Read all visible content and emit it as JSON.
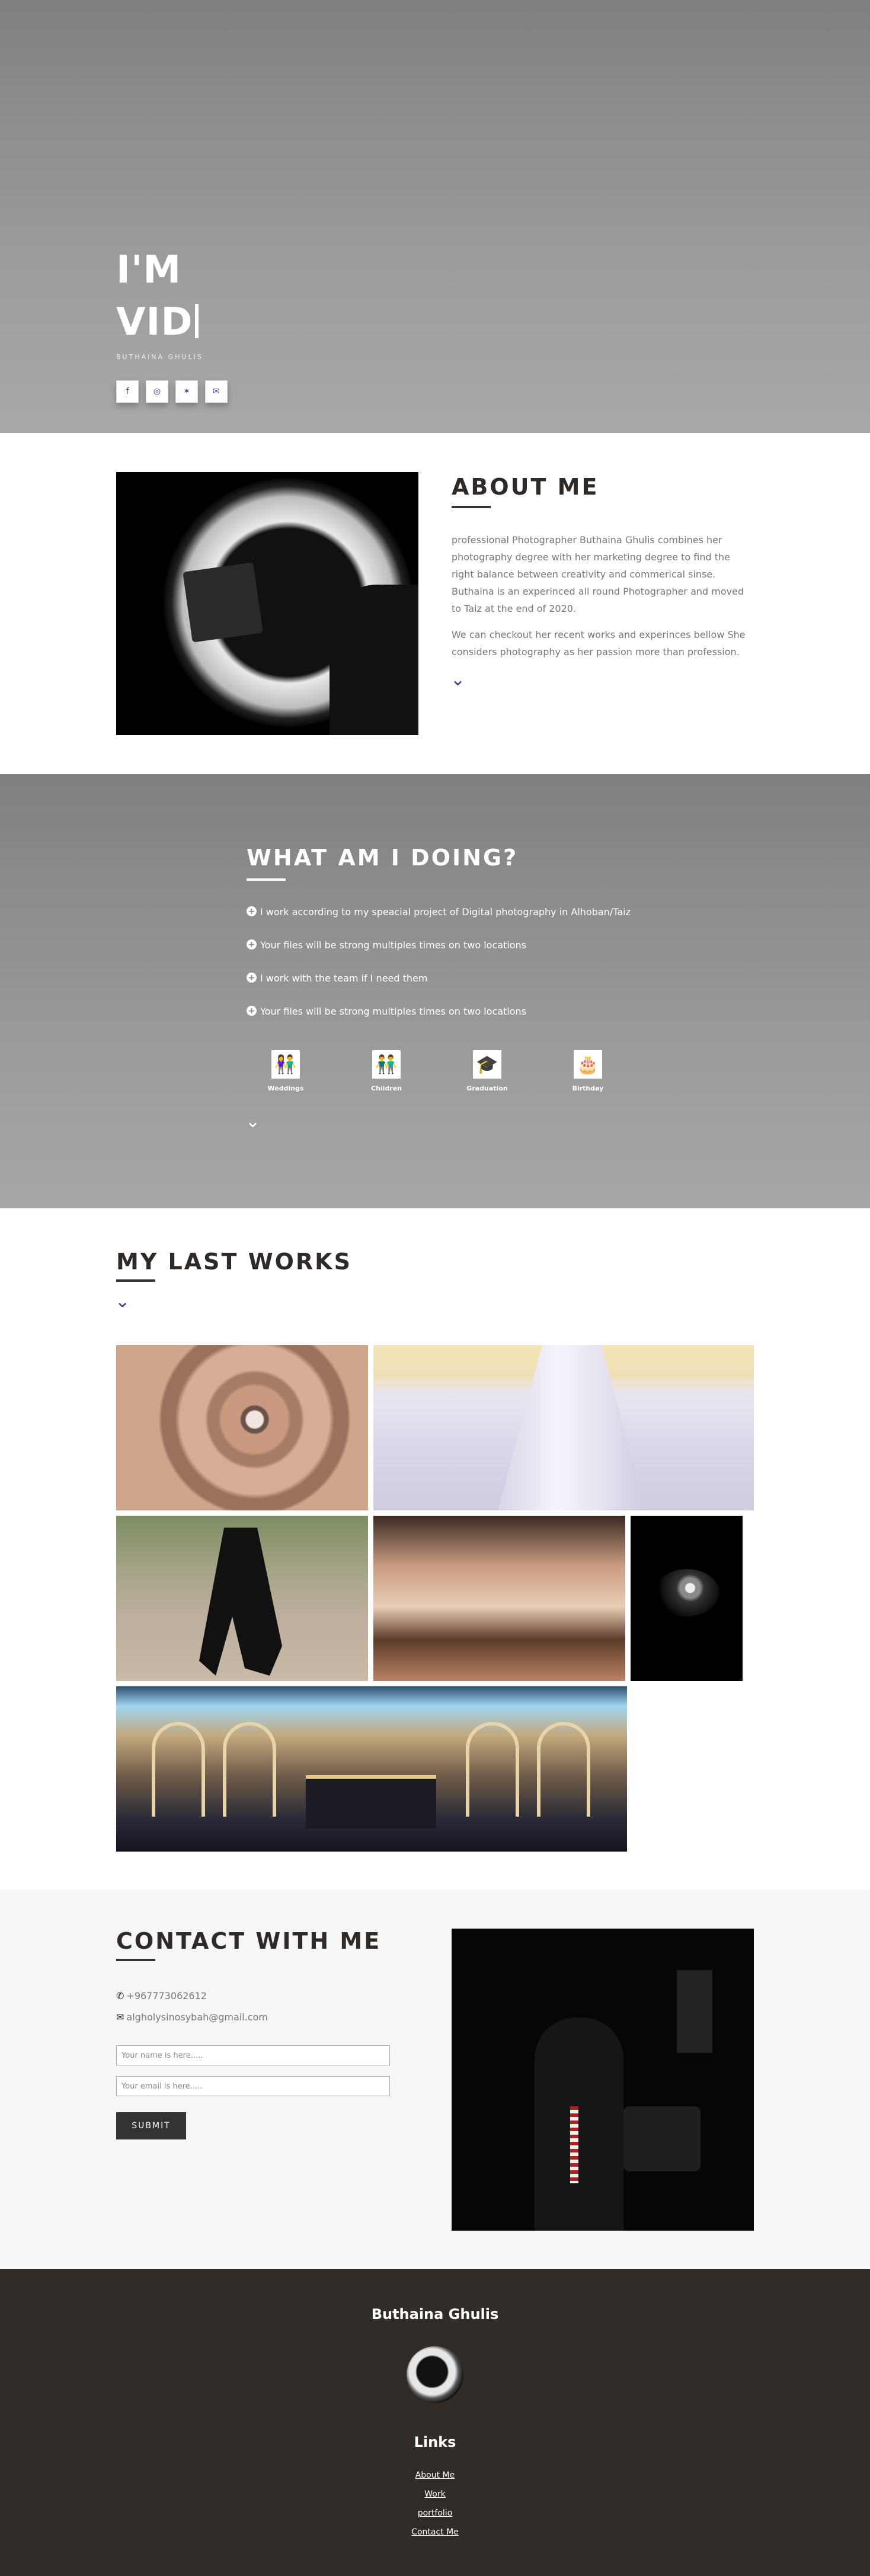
{
  "hero": {
    "title_line1": "I'M",
    "title_line2": "VID",
    "subtitle": "Buthaina Ghulis",
    "socials": [
      {
        "icon": "facebook-icon",
        "glyph": "f"
      },
      {
        "icon": "instagram-icon",
        "glyph": "◎"
      },
      {
        "icon": "twitter-icon",
        "glyph": "✶"
      },
      {
        "icon": "email-icon",
        "glyph": "✉"
      }
    ]
  },
  "about": {
    "heading": "ABOUT ME",
    "para1": "professional Photographer Buthaina Ghulis combines her photography degree with her marketing degree to find the right balance between creativity and commerical sinse. Buthaina is an experinced all round Photographer and moved to Taiz at the end of 2020.",
    "para2": "We can checkout her recent works and experinces bellow She considers photography as her passion more than profession.",
    "chevron": "⌄"
  },
  "doing": {
    "heading": "WHAT AM I DOING?",
    "items": [
      "I work according to my speacial project of Digital photography in Alhoban/Taiz",
      "Your files will be strong multiples times on two locations",
      "I work with the team if I need them",
      "Your files will be strong multiples times on two locations"
    ],
    "categories": [
      {
        "label": "Weddings",
        "icon": "wedding-couple-icon",
        "glyph": "👫"
      },
      {
        "label": "Children",
        "icon": "children-icon",
        "glyph": "👬"
      },
      {
        "label": "Graduation",
        "icon": "graduation-cap-icon",
        "glyph": "🎓"
      },
      {
        "label": "Birthday",
        "icon": "birthday-cake-icon",
        "glyph": "🎂"
      }
    ],
    "chevron": "⌄"
  },
  "works": {
    "heading": "MY LAST WORKS",
    "chevron": "⌄"
  },
  "contact": {
    "heading": "CONTACT WITH ME",
    "phone": "+967773062612",
    "email": "algholysinosybah@gmail.com",
    "name_placeholder": "Your name is here.....",
    "email_placeholder": "Your email is here.....",
    "submit_label": "SUBMIT"
  },
  "footer": {
    "name": "Buthaina Ghulis",
    "links_heading": "Links",
    "links": [
      "About Me",
      "Work",
      "portfolio",
      "Contact Me"
    ]
  }
}
